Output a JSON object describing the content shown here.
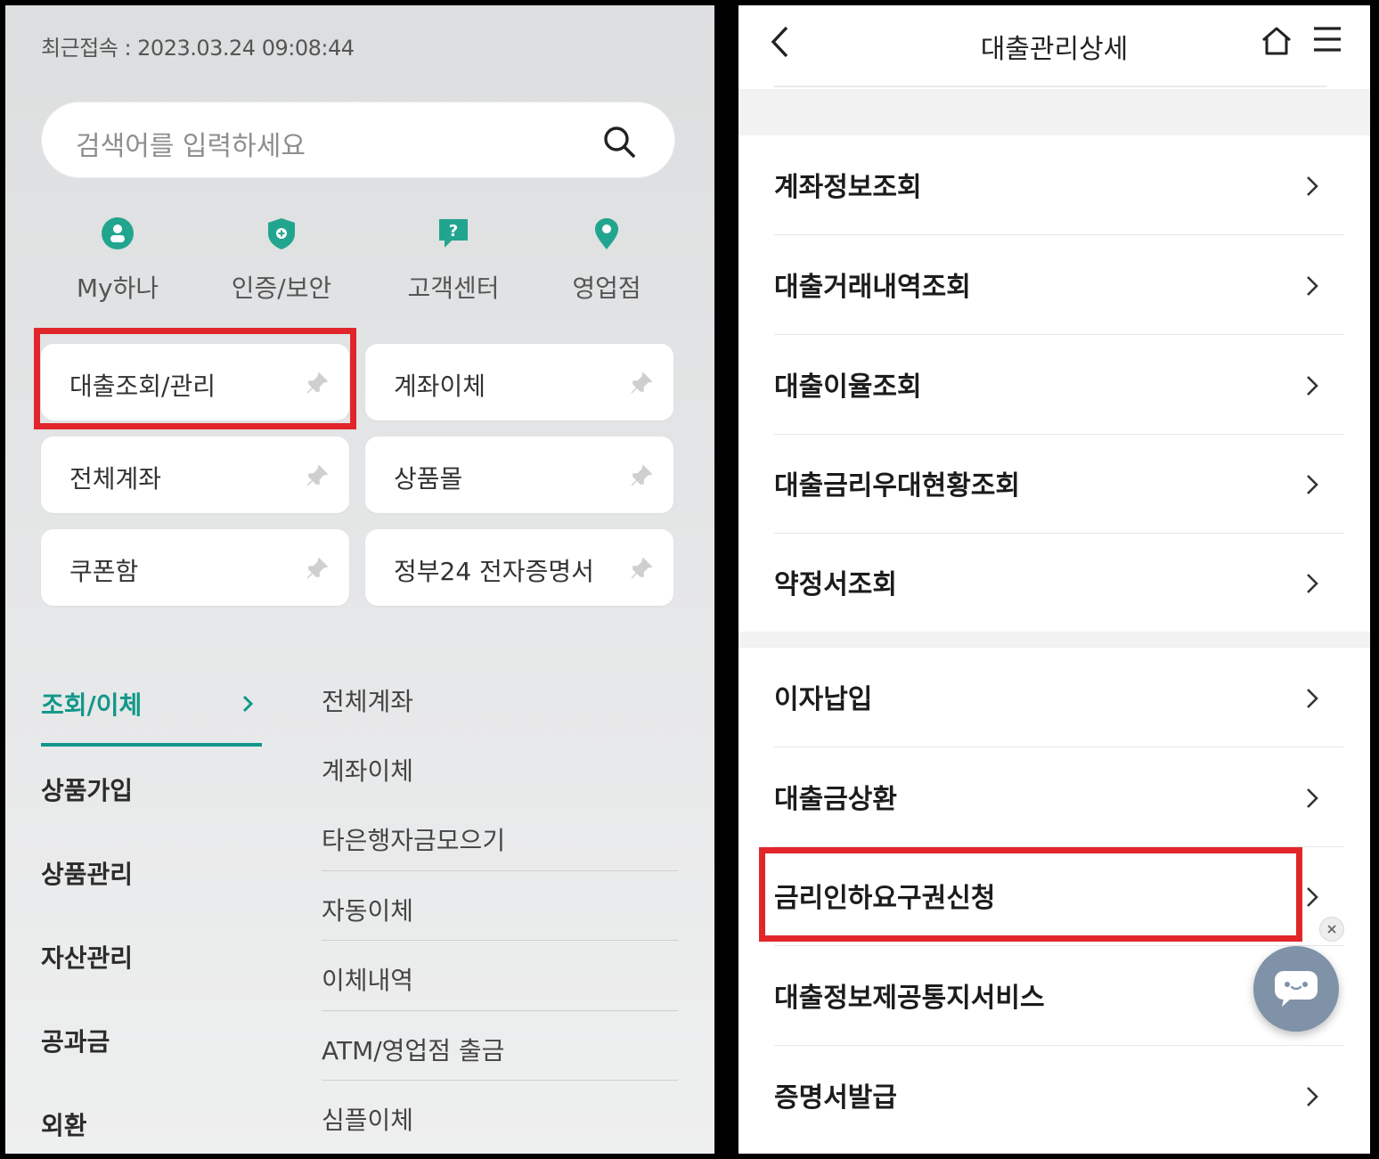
{
  "left": {
    "last_access": "최근접속 : 2023.03.24 09:08:44",
    "search_placeholder": "검색어를 입력하세요",
    "quick_menu": [
      {
        "label": "My하나",
        "icon": "person-icon"
      },
      {
        "label": "인증/보안",
        "icon": "shield-icon"
      },
      {
        "label": "고객센터",
        "icon": "help-chat-icon"
      },
      {
        "label": "영업점",
        "icon": "location-pin-icon"
      }
    ],
    "shortcuts": [
      {
        "label": "대출조회/관리",
        "highlighted": true
      },
      {
        "label": "계좌이체"
      },
      {
        "label": "전체계좌"
      },
      {
        "label": "상품몰"
      },
      {
        "label": "쿠폰함"
      },
      {
        "label": "정부24 전자증명서"
      }
    ],
    "categories": [
      "조회/이체",
      "상품가입",
      "상품관리",
      "자산관리",
      "공과금",
      "외환"
    ],
    "active_category": "조회/이체",
    "sub_items": [
      "전체계좌",
      "계좌이체",
      "타은행자금모으기",
      "자동이체",
      "이체내역",
      "ATM/영업점 출금",
      "심플이체"
    ]
  },
  "right": {
    "title": "대출관리상세",
    "group1": [
      "계좌정보조회",
      "대출거래내역조회",
      "대출이율조회",
      "대출금리우대현황조회",
      "약정서조회"
    ],
    "group2": [
      "이자납입",
      "대출금상환",
      "금리인하요구권신청",
      "대출정보제공통지서비스",
      "증명서발급"
    ],
    "highlighted_item": "금리인하요구권신청"
  },
  "colors": {
    "accent": "#11978a",
    "highlight_border": "#e1262b",
    "chat_button": "#7f92a7"
  }
}
